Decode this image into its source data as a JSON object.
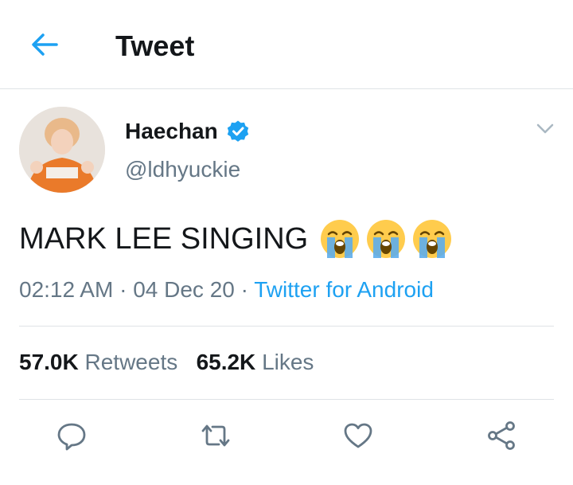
{
  "header": {
    "title": "Tweet",
    "back_icon": "arrow-left-icon"
  },
  "author": {
    "display_name": "Haechan",
    "handle": "@ldhyuckie",
    "verified": true,
    "verified_icon": "verified-badge-icon",
    "avatar_desc": "avatar"
  },
  "tweet": {
    "text": "MARK LEE SINGING",
    "emojis": [
      "loudly-crying-face-icon",
      "loudly-crying-face-icon",
      "loudly-crying-face-icon"
    ],
    "time": "02:12 AM",
    "date": "04 Dec 20",
    "separator": "·",
    "source": "Twitter for Android"
  },
  "stats": {
    "retweets_count": "57.0K",
    "retweets_label": "Retweets",
    "likes_count": "65.2K",
    "likes_label": "Likes"
  },
  "actions": [
    "reply-icon",
    "retweet-icon",
    "like-icon",
    "share-icon"
  ],
  "colors": {
    "accent": "#1da1f2",
    "text_primary": "#14171a",
    "text_secondary": "#657786",
    "divider": "#dfe3e6"
  }
}
